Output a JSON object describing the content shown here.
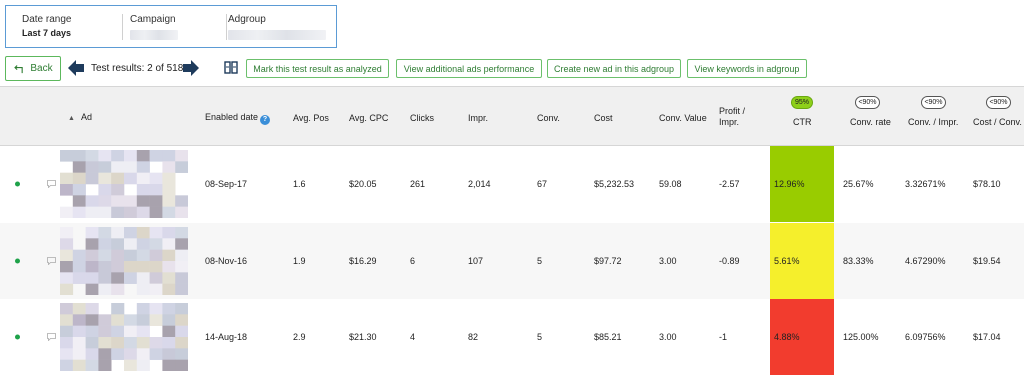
{
  "filters": {
    "date_range_label": "Date range",
    "date_range_value": "Last 7 days",
    "campaign_label": "Campaign",
    "adgroup_label": "Adgroup"
  },
  "toolbar": {
    "back_label": "Back",
    "test_results": "Test results: 2 of 518",
    "mark_analyzed": "Mark this test result as analyzed",
    "view_additional": "View additional ads performance",
    "create_new_ad": "Create new ad in this adgroup",
    "view_keywords": "View keywords in adgroup"
  },
  "table": {
    "headers": {
      "ad": "Ad",
      "enabled_date": "Enabled date",
      "avg_pos": "Avg. Pos",
      "avg_cpc": "Avg. CPC",
      "clicks": "Clicks",
      "impr": "Impr.",
      "conv": "Conv.",
      "cost": "Cost",
      "conv_value": "Conv. Value",
      "profit_impr_1": "Profit /",
      "profit_impr_2": "Impr.",
      "ctr": "CTR",
      "conv_rate": "Conv. rate",
      "conv_impr": "Conv. / Impr.",
      "cost_conv": "Cost / Conv."
    },
    "badges": {
      "ctr": "95%",
      "conv_rate": "<90%",
      "conv_impr": "<90%",
      "cost_conv": "<90%"
    },
    "colors": {
      "ctr_best": "#99cc00",
      "ctr_mid": "#f5ef2c",
      "ctr_worst": "#f23c2e",
      "badge_green": "#8ed01a",
      "active_dot": "#1fa24a"
    },
    "rows": [
      {
        "enabled_date": "08-Sep-17",
        "avg_pos": "1.6",
        "avg_cpc": "$20.05",
        "clicks": "261",
        "impr": "2,014",
        "conv": "67",
        "cost": "$5,232.53",
        "conv_value": "59.08",
        "profit_impr": "-2.57",
        "ctr": "12.96%",
        "conv_rate": "25.67%",
        "conv_impr": "3.32671%",
        "cost_conv": "$78.10",
        "ctr_color": "#99cc00"
      },
      {
        "enabled_date": "08-Nov-16",
        "avg_pos": "1.9",
        "avg_cpc": "$16.29",
        "clicks": "6",
        "impr": "107",
        "conv": "5",
        "cost": "$97.72",
        "conv_value": "3.00",
        "profit_impr": "-0.89",
        "ctr": "5.61%",
        "conv_rate": "83.33%",
        "conv_impr": "4.67290%",
        "cost_conv": "$19.54",
        "ctr_color": "#f5ef2c"
      },
      {
        "enabled_date": "14-Aug-18",
        "avg_pos": "2.9",
        "avg_cpc": "$21.30",
        "clicks": "4",
        "impr": "82",
        "conv": "5",
        "cost": "$85.21",
        "conv_value": "3.00",
        "profit_impr": "-1",
        "ctr": "4.88%",
        "conv_rate": "125.00%",
        "conv_impr": "6.09756%",
        "cost_conv": "$17.04",
        "ctr_color": "#f23c2e"
      }
    ]
  }
}
